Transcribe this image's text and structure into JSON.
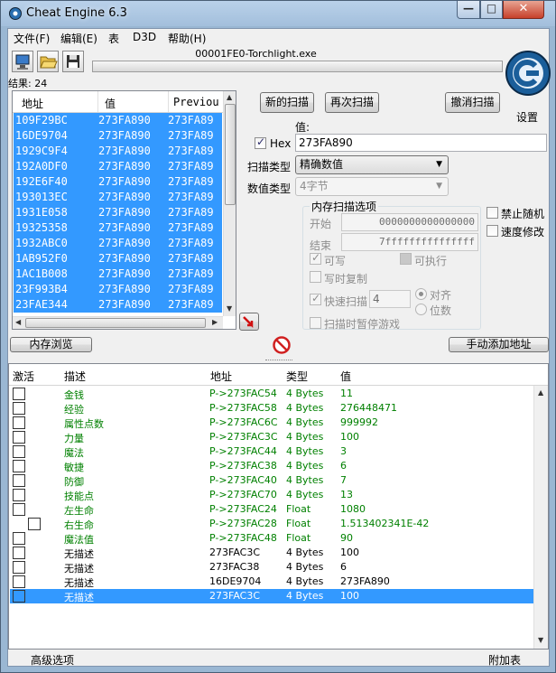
{
  "window": {
    "title": "Cheat Engine 6.3",
    "minimize": "—",
    "maximize": "□",
    "close": "✕"
  },
  "menu": [
    "文件(F)",
    "编辑(E)",
    "表",
    "D3D",
    "帮助(H)"
  ],
  "toolbar": {
    "process": "00001FE0-Torchlight.exe",
    "settings_label": "设置",
    "progress": 0
  },
  "results": {
    "label": "结果: 24"
  },
  "found_list": {
    "columns": [
      "地址",
      "值",
      "Previou"
    ],
    "rows": [
      [
        "109F29BC",
        "273FA890",
        "273FA89"
      ],
      [
        "16DE9704",
        "273FA890",
        "273FA89"
      ],
      [
        "1929C9F4",
        "273FA890",
        "273FA89"
      ],
      [
        "192A0DF0",
        "273FA890",
        "273FA89"
      ],
      [
        "192E6F40",
        "273FA890",
        "273FA89"
      ],
      [
        "193013EC",
        "273FA890",
        "273FA89"
      ],
      [
        "1931E058",
        "273FA890",
        "273FA89"
      ],
      [
        "19325358",
        "273FA890",
        "273FA89"
      ],
      [
        "1932ABC0",
        "273FA890",
        "273FA89"
      ],
      [
        "1AB952F0",
        "273FA890",
        "273FA89"
      ],
      [
        "1AC1B008",
        "273FA890",
        "273FA89"
      ],
      [
        "23F993B4",
        "273FA890",
        "273FA89"
      ],
      [
        "23FAE344",
        "273FA890",
        "273FA89"
      ]
    ]
  },
  "scan": {
    "new_scan": "新的扫描",
    "next_scan": "再次扫描",
    "undo_scan": "撤消扫描",
    "value_label": "值:",
    "hex_label": "Hex",
    "value": "273FA890",
    "scan_type_label": "扫描类型",
    "scan_type": "精确数值",
    "value_type_label": "数值类型",
    "value_type": "4字节",
    "mem_options_title": "内存扫描选项",
    "start_label": "开始",
    "start_value": "0000000000000000",
    "stop_label": "结束",
    "stop_value": "7fffffffffffffff",
    "writable": "可写",
    "executable": "可执行",
    "copy_on_write": "写时复制",
    "fast_scan": "快速扫描",
    "fast_scan_value": "4",
    "align": "对齐",
    "last_digits": "位数",
    "pause_game": "扫描时暂停游戏",
    "disable_random": "禁止随机",
    "speedhack": "速度修改"
  },
  "buttons": {
    "memory_view": "内存浏览",
    "add_address": "手动添加地址"
  },
  "table": {
    "columns": [
      "激活",
      "描述",
      "地址",
      "类型",
      "值"
    ],
    "rows": [
      {
        "desc": "金钱",
        "addr": "P->273FAC54",
        "type": "4 Bytes",
        "value": "11",
        "green": true
      },
      {
        "desc": "经验",
        "addr": "P->273FAC58",
        "type": "4 Bytes",
        "value": "276448471",
        "green": true
      },
      {
        "desc": "属性点数",
        "addr": "P->273FAC6C",
        "type": "4 Bytes",
        "value": "999992",
        "green": true
      },
      {
        "desc": "力量",
        "addr": "P->273FAC3C",
        "type": "4 Bytes",
        "value": "100",
        "green": true
      },
      {
        "desc": "魔法",
        "addr": "P->273FAC44",
        "type": "4 Bytes",
        "value": "3",
        "green": true
      },
      {
        "desc": "敏捷",
        "addr": "P->273FAC38",
        "type": "4 Bytes",
        "value": "6",
        "green": true
      },
      {
        "desc": "防御",
        "addr": "P->273FAC40",
        "type": "4 Bytes",
        "value": "7",
        "green": true
      },
      {
        "desc": "技能点",
        "addr": "P->273FAC70",
        "type": "4 Bytes",
        "value": "13",
        "green": true
      },
      {
        "desc": "左生命",
        "addr": "P->273FAC24",
        "type": "Float",
        "value": "1080",
        "green": true
      },
      {
        "desc": "右生命",
        "addr": "P->273FAC28",
        "type": "Float",
        "value": "1.513402341E-42",
        "green": true,
        "indent": true
      },
      {
        "desc": "魔法值",
        "addr": "P->273FAC48",
        "type": "Float",
        "value": "90",
        "green": true
      },
      {
        "desc": "无描述",
        "addr": "273FAC3C",
        "type": "4 Bytes",
        "value": "100",
        "green": false
      },
      {
        "desc": "无描述",
        "addr": "273FAC38",
        "type": "4 Bytes",
        "value": "6",
        "green": false
      },
      {
        "desc": "无描述",
        "addr": "16DE9704",
        "type": "4 Bytes",
        "value": "273FA890",
        "green": false
      },
      {
        "desc": "无描述",
        "addr": "273FAC3C",
        "type": "4 Bytes",
        "value": "100",
        "green": false,
        "selected": true
      }
    ]
  },
  "status": {
    "advanced": "高级选项",
    "extras": "附加表"
  }
}
